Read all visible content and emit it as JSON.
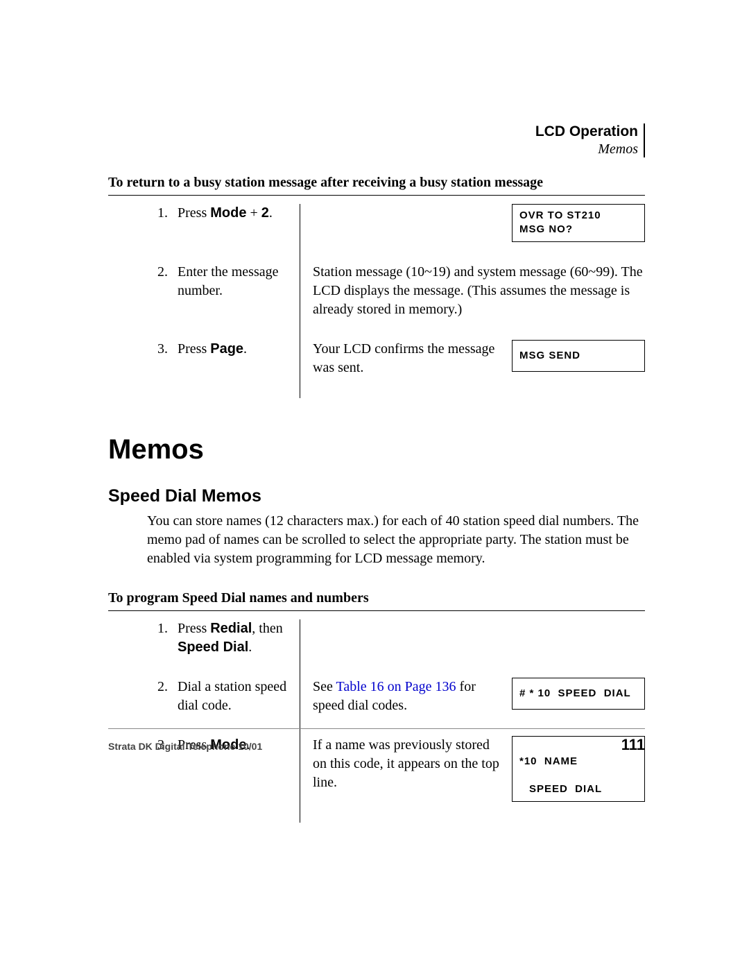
{
  "header": {
    "chapter": "LCD Operation",
    "section": "Memos"
  },
  "proc1": {
    "title": "To return to a busy station message after receiving a busy station message",
    "steps": [
      {
        "num": "1.",
        "act_pre": "Press ",
        "act_key": "Mode",
        "act_post": " + ",
        "act_key2": "2",
        "act_post2": ".",
        "lcd": "OVR TO ST210\nMSG NO?"
      },
      {
        "num": "2.",
        "act": "Enter the message number.",
        "res": "Station message (10~19) and system message (60~99). The LCD displays the message. (This assumes the message is already stored in memory.)"
      },
      {
        "num": "3.",
        "act_pre": "Press ",
        "act_key": "Page",
        "act_post": ".",
        "res": "Your LCD confirms the message was sent.",
        "lcd": "MSG SEND"
      }
    ]
  },
  "h1": "Memos",
  "h2": "Speed Dial Memos",
  "para": "You can store names (12 characters max.) for each of 40 station speed dial numbers. The memo pad of names can be scrolled to select the appropriate party. The station must be enabled via system programming for LCD message memory.",
  "proc2": {
    "title": "To program Speed Dial names and numbers",
    "steps": [
      {
        "num": "1.",
        "act_pre": "Press ",
        "act_key": "Redial",
        "act_mid": ", then ",
        "act_key2": "Speed Dial",
        "act_post": "."
      },
      {
        "num": "2.",
        "act": "Dial a station speed dial code.",
        "res_pre": "See ",
        "res_xref": "Table 16 on Page 136",
        "res_post": " for speed dial codes.",
        "lcd": "# * 10  SPEED  DIAL"
      },
      {
        "num": "3.",
        "act_pre": "Press ",
        "act_key": "Mode",
        "act_post": ".",
        "res": "If a name was previously stored on this code, it appears on the top line.",
        "lcd_l1": "*10  NAME",
        "lcd_l2_indent": "SPEED  DIAL"
      }
    ]
  },
  "footer": {
    "left": "Strata DK Digital Telephone   10/01",
    "right": "111"
  }
}
